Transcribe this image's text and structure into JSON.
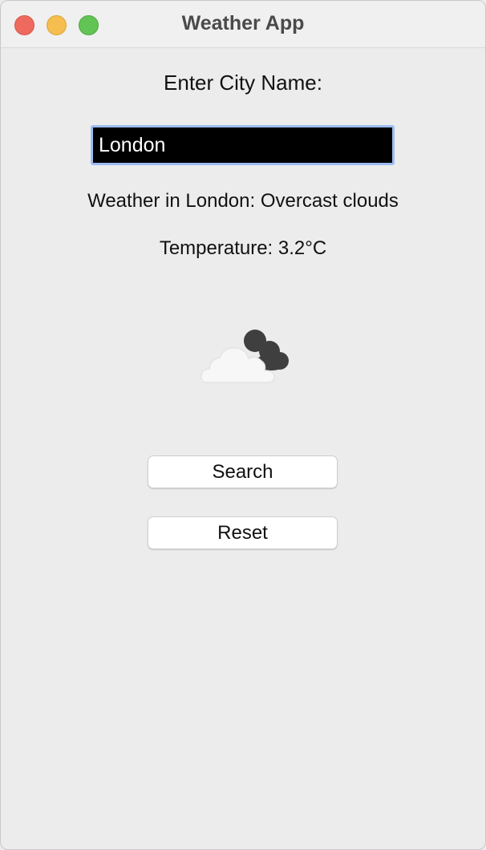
{
  "window": {
    "title": "Weather App"
  },
  "form": {
    "city_label": "Enter City Name:",
    "city_value": "London"
  },
  "result": {
    "weather_text": "Weather in London: Overcast clouds",
    "temperature_text": "Temperature: 3.2°C",
    "icon": "overcast-clouds-icon"
  },
  "buttons": {
    "search_label": "Search",
    "reset_label": "Reset"
  },
  "colors": {
    "close": "#ee6a5f",
    "minimize": "#f5be4f",
    "zoom": "#61c454",
    "input_bg": "#000000",
    "input_focus_ring": "#9bbcf0"
  }
}
